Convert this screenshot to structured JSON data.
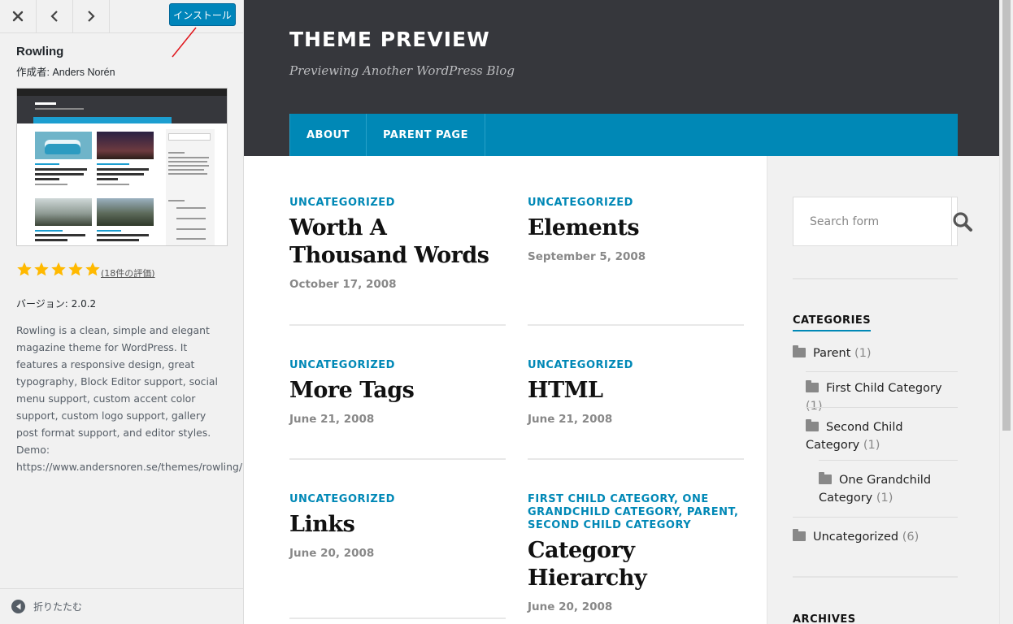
{
  "panel": {
    "install_label": "インストール",
    "theme_name": "Rowling",
    "author_line": "作成者: Anders Norén",
    "rating_stars": 5,
    "rating_count": "(18件の評価)",
    "version": "バージョン: 2.0.2",
    "description": "Rowling is a clean, simple and elegant magazine theme for WordPress. It features a responsive design, great typography, Block Editor support, social menu support, custom accent color support, custom logo support, gallery post format support, and editor styles. Demo: https://www.andersnoren.se/themes/rowling/",
    "collapse_label": "折りたたむ",
    "accent_color": "#0085ba"
  },
  "site": {
    "title": "THEME PREVIEW",
    "description": "Previewing Another WordPress Blog",
    "nav": [
      "ABOUT",
      "PARENT PAGE"
    ],
    "accent_color": "#0088b6",
    "header_color": "#36373c"
  },
  "posts": [
    {
      "category": "UNCATEGORIZED",
      "title": "Worth A Thousand Words",
      "date": "October 17, 2008"
    },
    {
      "category": "UNCATEGORIZED",
      "title": "Elements",
      "date": "September 5, 2008"
    },
    {
      "category": "UNCATEGORIZED",
      "title": "More Tags",
      "date": "June 21, 2008"
    },
    {
      "category": "UNCATEGORIZED",
      "title": "HTML",
      "date": "June 21, 2008"
    },
    {
      "category": "UNCATEGORIZED",
      "title": "Links",
      "date": "June 20, 2008"
    },
    {
      "category": "FIRST CHILD CATEGORY, ONE GRANDCHILD CATEGORY, PARENT, SECOND CHILD CATEGORY",
      "title": "Category Hierarchy",
      "date": "June 20, 2008"
    }
  ],
  "sidebar": {
    "search_placeholder": "Search form",
    "categories_title": "CATEGORIES",
    "categories": [
      {
        "name": "Parent",
        "count": "(1)"
      },
      {
        "name": "First Child Category",
        "count": "(1)"
      },
      {
        "name": "Second Child Category",
        "count": "(1)"
      },
      {
        "name": "One Grandchild Category",
        "count": "(1)"
      },
      {
        "name": "Uncategorized",
        "count": "(6)"
      }
    ],
    "archives_title": "ARCHIVES"
  }
}
